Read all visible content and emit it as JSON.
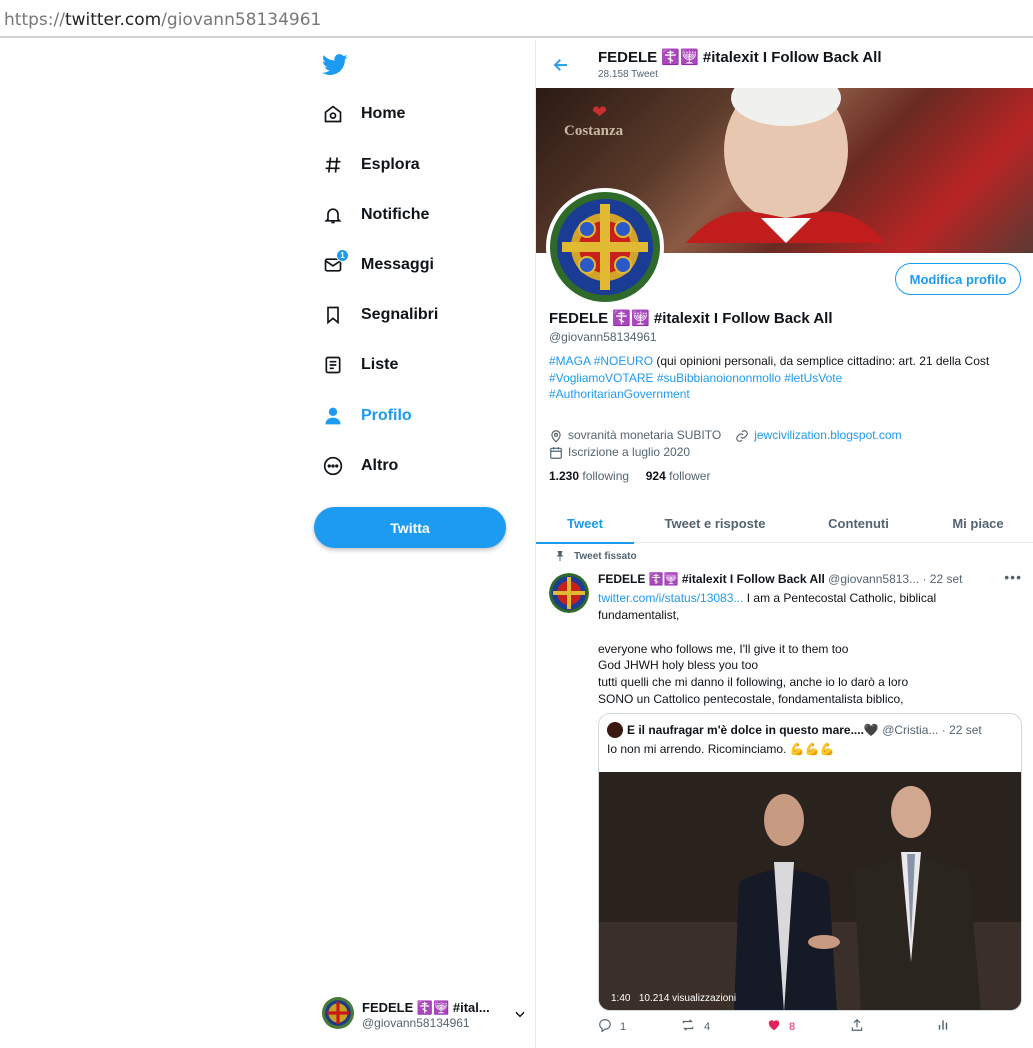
{
  "browser": {
    "url_scheme": "https://",
    "url_host": "twitter.com",
    "url_path": "/giovann58134961"
  },
  "nav": {
    "items": [
      {
        "label": "Home",
        "icon": "home-icon"
      },
      {
        "label": "Esplora",
        "icon": "hashtag-icon"
      },
      {
        "label": "Notifiche",
        "icon": "bell-icon"
      },
      {
        "label": "Messaggi",
        "icon": "mail-icon",
        "badge": "1"
      },
      {
        "label": "Segnalibri",
        "icon": "bookmark-icon"
      },
      {
        "label": "Liste",
        "icon": "list-icon"
      },
      {
        "label": "Profilo",
        "icon": "user-icon",
        "active": true
      },
      {
        "label": "Altro",
        "icon": "more-circle-icon"
      }
    ],
    "tweet_button": "Twitta",
    "account": {
      "name": "FEDELE ☦️🕎 #ital...",
      "handle": "@giovann58134961"
    }
  },
  "header": {
    "title": "FEDELE ☦️🕎 #italexit I Follow Back All",
    "tweet_count": "28.158 Tweet"
  },
  "banner": {
    "brand": "Costanza"
  },
  "profile": {
    "edit_button": "Modifica profilo",
    "name": "FEDELE ☦️🕎 #italexit I Follow Back All",
    "handle": "@giovann58134961",
    "bio_tag1": "#MAGA",
    "bio_tag2": "#NOEURO",
    "bio_text1": " (qui opinioni personali, da semplice cittadino: art. 21 della Cost",
    "bio_tags_line2": "#VogliamoVOTARE #suBibbianoiononmollo #letUsVote",
    "bio_tags_line3": "#AuthoritarianGovernment",
    "location": "sovranità monetaria SUBITO",
    "website": "jewcivilization.blogspot.com",
    "joined": "Iscrizione a luglio 2020",
    "following_count": "1.230",
    "following_label": "following",
    "followers_count": "924",
    "followers_label": "follower"
  },
  "tabs": [
    "Tweet",
    "Tweet e risposte",
    "Contenuti",
    "Mi piace"
  ],
  "tweet": {
    "pinned_label": "Tweet fissato",
    "author_name": "FEDELE ☦️🕎 #italexit I Follow Back All",
    "author_handle": "@giovann5813...",
    "date": "· 22 set",
    "link": "twitter.com/i/status/13083...",
    "line1": "  I am a Pentecostal Catholic, biblical",
    "line2": "fundamentalist,",
    "line3": "everyone who follows me, I'll give it to them too",
    "line4": "God JHWH holy bless you too",
    "line5": "tutti quelli che mi danno il following, anche io lo darò a loro",
    "line6": "SONO un Cattolico pentecostale, fondamentalista biblico,",
    "quote": {
      "author_name": "E il naufragar m'è dolce in questo mare....🖤",
      "author_handle": "@Cristia...",
      "date": "· 22 set",
      "text": "Io non mi arrendo. Ricominciamo. 💪💪💪",
      "video_duration": "1:40",
      "video_views": "10.214 visualizzazioni"
    },
    "replies": "1",
    "retweets": "4",
    "likes": "8"
  },
  "colors": {
    "accent": "#1d9bf0",
    "like": "#e0245e"
  }
}
